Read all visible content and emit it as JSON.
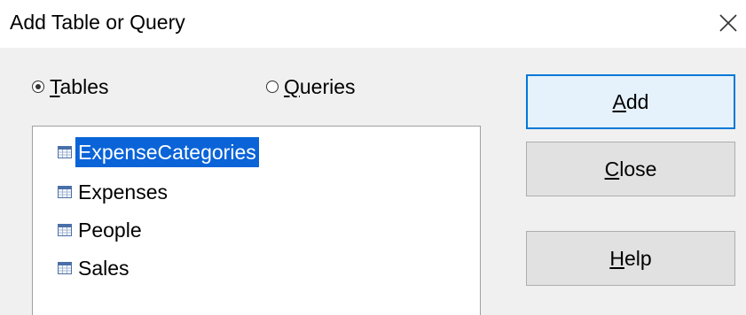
{
  "window": {
    "title": "Add Table or Query"
  },
  "radios": {
    "tables": {
      "mnemonic": "T",
      "rest": "ables",
      "checked": true
    },
    "queries": {
      "mnemonic": "Q",
      "rest": "ueries",
      "checked": false
    }
  },
  "list": {
    "items": [
      {
        "label": "ExpenseCategories",
        "selected": true
      },
      {
        "label": "Expenses",
        "selected": false
      },
      {
        "label": "People",
        "selected": false
      },
      {
        "label": "Sales",
        "selected": false
      }
    ]
  },
  "buttons": {
    "add": {
      "mnemonic": "A",
      "rest": "dd"
    },
    "close": {
      "mnemonic": "C",
      "rest": "lose"
    },
    "help": {
      "mnemonic": "H",
      "rest": "elp"
    }
  },
  "colors": {
    "selection": "#0a64d8",
    "default_button_border": "#0078d7",
    "dialog_background": "#f0f0f0"
  },
  "icons": {
    "close": "close-x-icon",
    "table": "table-icon"
  }
}
